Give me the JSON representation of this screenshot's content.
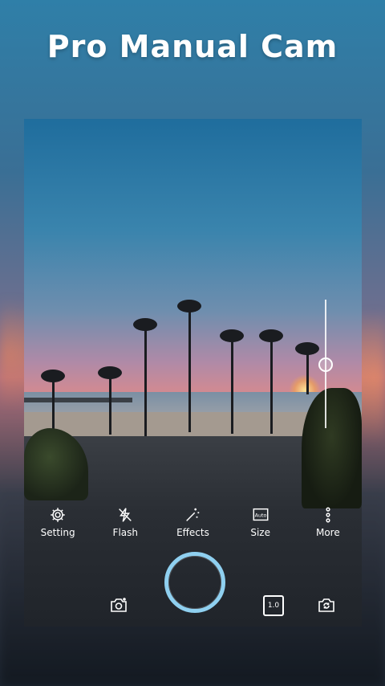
{
  "app": {
    "title": "Pro Manual Cam"
  },
  "toolbar": {
    "items": [
      {
        "label": "Setting",
        "icon": "gear-icon"
      },
      {
        "label": "Flash",
        "icon": "flash-off-icon"
      },
      {
        "label": "Effects",
        "icon": "magic-wand-icon"
      },
      {
        "label": "Size",
        "icon": "auto-size-icon"
      },
      {
        "label": "More",
        "icon": "more-vertical-icon"
      }
    ],
    "size_badge": "Auto"
  },
  "controls": {
    "ratio_label": "1.0",
    "shutter_color": "#8fd0f0"
  }
}
